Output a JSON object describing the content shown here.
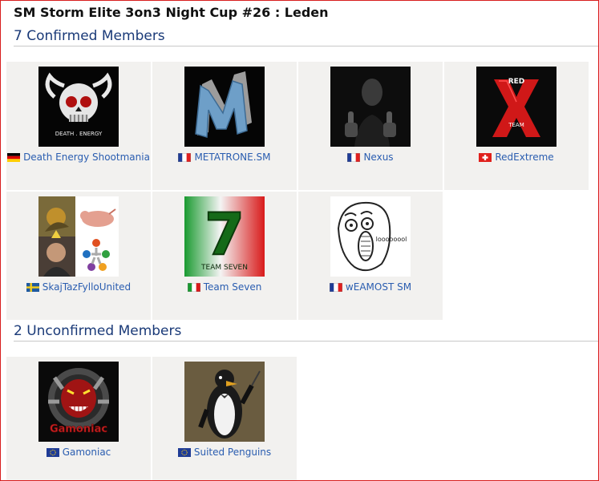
{
  "page": {
    "title": "SM Storm Elite 3on3 Night Cup #26 : Leden"
  },
  "confirmed": {
    "heading": "7 Confirmed Members",
    "members": [
      {
        "name": "Death Energy Shootmania",
        "flag": "de",
        "logo": "skull-emblem",
        "logo_text": "DEATH . ENERGY"
      },
      {
        "name": "METATRONE.SM",
        "flag": "fr",
        "logo": "letter-m-emblem"
      },
      {
        "name": "Nexus",
        "flag": "fr",
        "logo": "dark-portrait"
      },
      {
        "name": "RedExtreme",
        "flag": "ch",
        "logo": "red-x-emblem",
        "logo_text_top": "RED",
        "logo_text_bottom": "TEAM"
      },
      {
        "name": "SkajTazFylloUnited",
        "flag": "se",
        "logo": "collage"
      },
      {
        "name": "Team Seven",
        "flag": "it",
        "logo": "number-seven-emblem",
        "logo_number": "7",
        "logo_text": "TEAM SEVEN"
      },
      {
        "name": "wEAMOST SM",
        "flag": "fr",
        "logo": "rage-face",
        "logo_text": "loooooool"
      }
    ]
  },
  "unconfirmed": {
    "heading": "2 Unconfirmed Members",
    "members": [
      {
        "name": "Gamoniac",
        "flag": "eu",
        "logo": "demon-emblem",
        "logo_text": "Gamoniac"
      },
      {
        "name": "Suited Penguins",
        "flag": "eu",
        "logo": "penguin-portrait"
      }
    ]
  },
  "colors": {
    "frame_border": "#d81e1e",
    "link": "#2a5db0",
    "section_heading": "#1a3a78",
    "card_background": "#f2f1ef"
  }
}
